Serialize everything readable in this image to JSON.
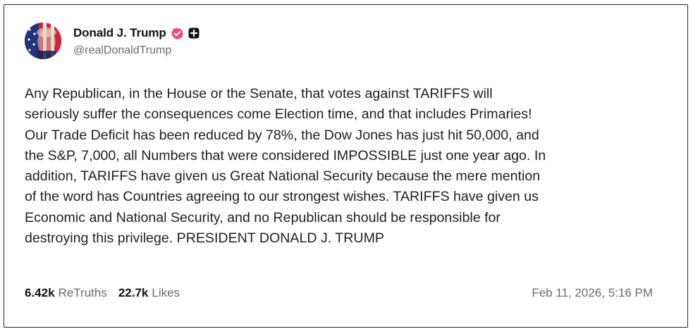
{
  "post": {
    "author": {
      "display_name": "Donald J. Trump",
      "handle": "@realDonaldTrump",
      "verified_icon": "verified-badge-icon",
      "verified_color": "#e8508a",
      "extra_icon": "plus-square-icon"
    },
    "text": "Any Republican, in the House or the Senate, that votes against TARIFFS will\nseriously suffer the consequences come Election time, and that includes Primaries!\nOur Trade Deficit has been reduced by 78%, the Dow Jones has just hit 50,000, and\nthe S&P, 7,000, all Numbers that were considered IMPOSSIBLE just one year ago. In\naddition, TARIFFS have given us Great National Security because the mere mention\nof the word has Countries agreeing to our strongest wishes. TARIFFS have given us\nEconomic and National Security, and no Republican should be responsible for\ndestroying this privilege. PRESIDENT DONALD J. TRUMP",
    "stats": {
      "retruths_count": "6.42k",
      "retruths_label": "ReTruths",
      "likes_count": "22.7k",
      "likes_label": "Likes"
    },
    "timestamp": "Feb 11, 2026, 5:16 PM"
  }
}
